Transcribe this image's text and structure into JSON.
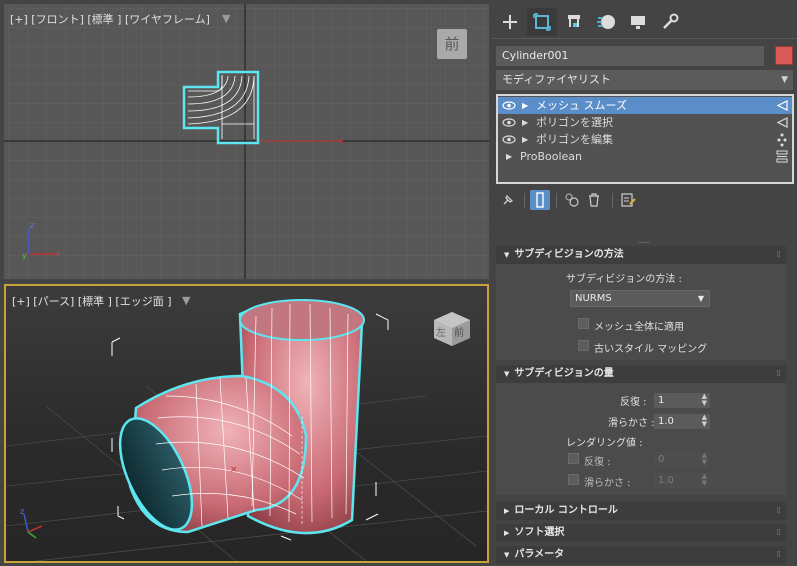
{
  "viewports": {
    "front": {
      "label": "[+] [フロント] [標準 ] [ワイヤフレーム]",
      "viewcube_face": "前"
    },
    "perspective": {
      "label": "[+] [パース] [標準 ] [エッジ面 ]",
      "viewcube_faces": [
        "左",
        "前"
      ]
    }
  },
  "command_panel": {
    "tabs": [
      "create-icon",
      "modify-icon",
      "hierarchy-icon",
      "motion-icon",
      "display-icon",
      "utilities-icon"
    ],
    "active_tab": "modify-icon",
    "object_name": "Cylinder001",
    "object_color": "#d95a57",
    "modifier_list_label": "モディファイヤリスト",
    "stack": [
      {
        "label": "メッシュ スムーズ",
        "selected": true
      },
      {
        "label": "ポリゴンを選択",
        "selected": false
      },
      {
        "label": "ポリゴンを編集",
        "selected": false
      },
      {
        "label": "ProBoolean",
        "selected": false
      }
    ]
  },
  "rollouts": {
    "subdivision_method": {
      "title": "サブディビジョンの方法",
      "method_label": "サブディビジョンの方法 :",
      "method_value": "NURMS",
      "apply_whole_mesh": "メッシュ全体に適用",
      "old_style_mapping": "古いスタイル マッピング"
    },
    "subdivision_amount": {
      "title": "サブディビジョンの量",
      "iterations_label": "反復 :",
      "iterations_value": "1",
      "smoothness_label": "滑らかさ :",
      "smoothness_value": "1.0",
      "render_values_label": "レンダリング値 :",
      "render_iterations_label": "反復 :",
      "render_iterations_value": "0",
      "render_smoothness_label": "滑らかさ :",
      "render_smoothness_value": "1.0"
    },
    "local_control": {
      "title": "ローカル コントロール"
    },
    "soft_selection": {
      "title": "ソフト選択"
    },
    "parameters": {
      "title": "パラメータ"
    }
  }
}
